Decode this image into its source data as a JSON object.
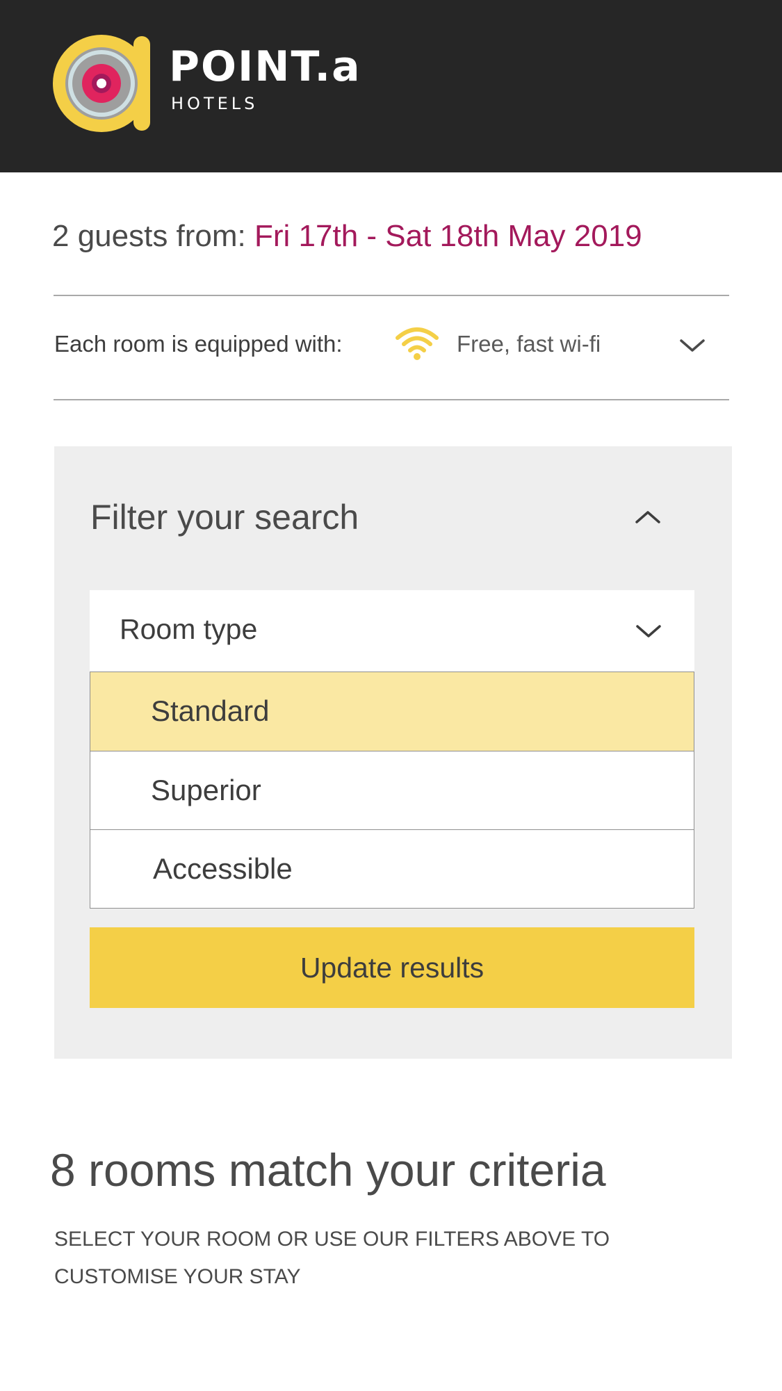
{
  "brand": {
    "name": "POINT.a",
    "sub": "HOTELS",
    "colors": {
      "header_bg": "#262626",
      "logo_yellow": "#f4cf47",
      "logo_grey": "#9b9b9b",
      "logo_pink": "#e0245e"
    }
  },
  "booking": {
    "guests_label": "2 guests from:",
    "dates": "Fri 17th - Sat 18th May 2019",
    "dates_color": "#a3195b"
  },
  "amenities": {
    "label": "Each room is equipped with:",
    "icon": "wifi-icon",
    "text": "Free, fast wi-fi",
    "expand_icon": "chevron-down-icon"
  },
  "filter": {
    "title": "Filter your search",
    "collapse_icon": "chevron-up-icon",
    "room_type": {
      "label": "Room type",
      "icon": "chevron-down-icon",
      "options": [
        {
          "label": "Standard",
          "selected": true
        },
        {
          "label": "Superior",
          "selected": false
        },
        {
          "label": "Accessible",
          "selected": false
        }
      ],
      "highlight_color": "#fae8a3"
    },
    "update_label": "Update results",
    "button_color": "#f4cf47"
  },
  "results": {
    "title": "8 rooms match your criteria",
    "subtitle": "SELECT YOUR ROOM OR USE OUR FILTERS ABOVE TO CUSTOMISE YOUR STAY"
  }
}
